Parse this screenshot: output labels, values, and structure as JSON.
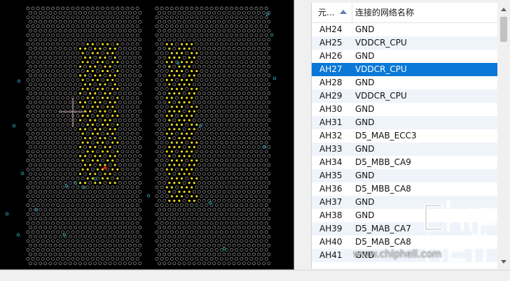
{
  "board_view": {
    "name": "pcb-pin-map",
    "colors": {
      "background": "#000000",
      "pad_outline": "#9a9a9a",
      "highlight_pad": "#e8d81c",
      "selected_pad": "#e01010",
      "via": "#2aa7b0",
      "crosshair": "#d8aeb8"
    }
  },
  "pin_list": {
    "columns": {
      "pin": "元...",
      "net": "连接的网络名称"
    },
    "sort_indicator": "sort-ascending-icon",
    "rows": [
      {
        "pin": "AH24",
        "net": "GND"
      },
      {
        "pin": "AH25",
        "net": "VDDCR_CPU"
      },
      {
        "pin": "AH26",
        "net": "GND"
      },
      {
        "pin": "AH27",
        "net": "VDDCR_CPU",
        "selected": true
      },
      {
        "pin": "AH28",
        "net": "GND"
      },
      {
        "pin": "AH29",
        "net": "VDDCR_CPU"
      },
      {
        "pin": "AH30",
        "net": "GND"
      },
      {
        "pin": "AH31",
        "net": "GND"
      },
      {
        "pin": "AH32",
        "net": "D5_MAB_ECC3"
      },
      {
        "pin": "AH33",
        "net": "GND"
      },
      {
        "pin": "AH34",
        "net": "D5_MBB_CA9"
      },
      {
        "pin": "AH35",
        "net": "GND"
      },
      {
        "pin": "AH36",
        "net": "D5_MBB_CA8"
      },
      {
        "pin": "AH37",
        "net": "GND"
      },
      {
        "pin": "AH38",
        "net": "GND"
      },
      {
        "pin": "AH39",
        "net": "D5_MAB_CA7"
      },
      {
        "pin": "AH40",
        "net": "D5_MAB_CA8"
      },
      {
        "pin": "AH41",
        "net": "GND"
      }
    ],
    "selected_color": "#0a78d7",
    "alt_row_color": "#eff4fb"
  },
  "watermark": {
    "text": "www.chiphell.com",
    "logo": "chiphell-logo-icon"
  }
}
